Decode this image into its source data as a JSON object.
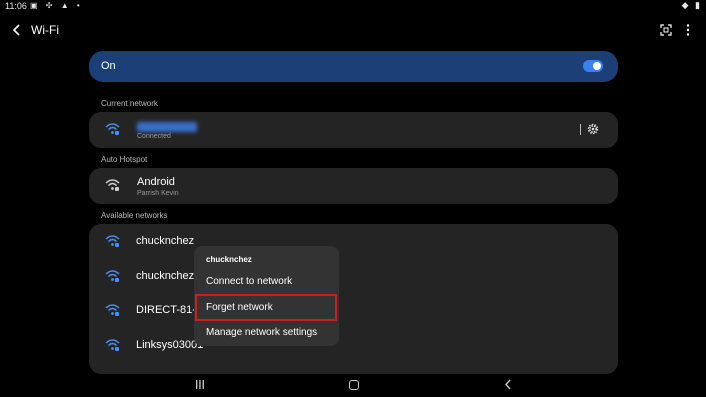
{
  "status_bar": {
    "time": "11:06",
    "left_icons": "▣ ✣ ▲ •",
    "right_icons": "◆ ▮"
  },
  "header": {
    "title": "Wi-Fi"
  },
  "wifi_toggle": {
    "label": "On",
    "state": "on"
  },
  "current_network": {
    "section_label": "Current network",
    "ssid": "",
    "status": "Connected"
  },
  "auto_hotspot": {
    "section_label": "Auto Hotspot",
    "name": "Android",
    "owner": "Parrish Kevin"
  },
  "available": {
    "section_label": "Available networks",
    "networks": [
      {
        "name": "chucknchez"
      },
      {
        "name": "chucknchez"
      },
      {
        "name": "DIRECT-81-E"
      },
      {
        "name": "Linksys03001"
      }
    ]
  },
  "context_menu": {
    "title": "chucknchez",
    "items": [
      "Connect to network",
      "Forget network",
      "Manage network settings"
    ],
    "highlighted": "Forget network"
  },
  "colors": {
    "accent": "#3b82f0",
    "card": "#242424",
    "highlight": "#d01c1c"
  }
}
